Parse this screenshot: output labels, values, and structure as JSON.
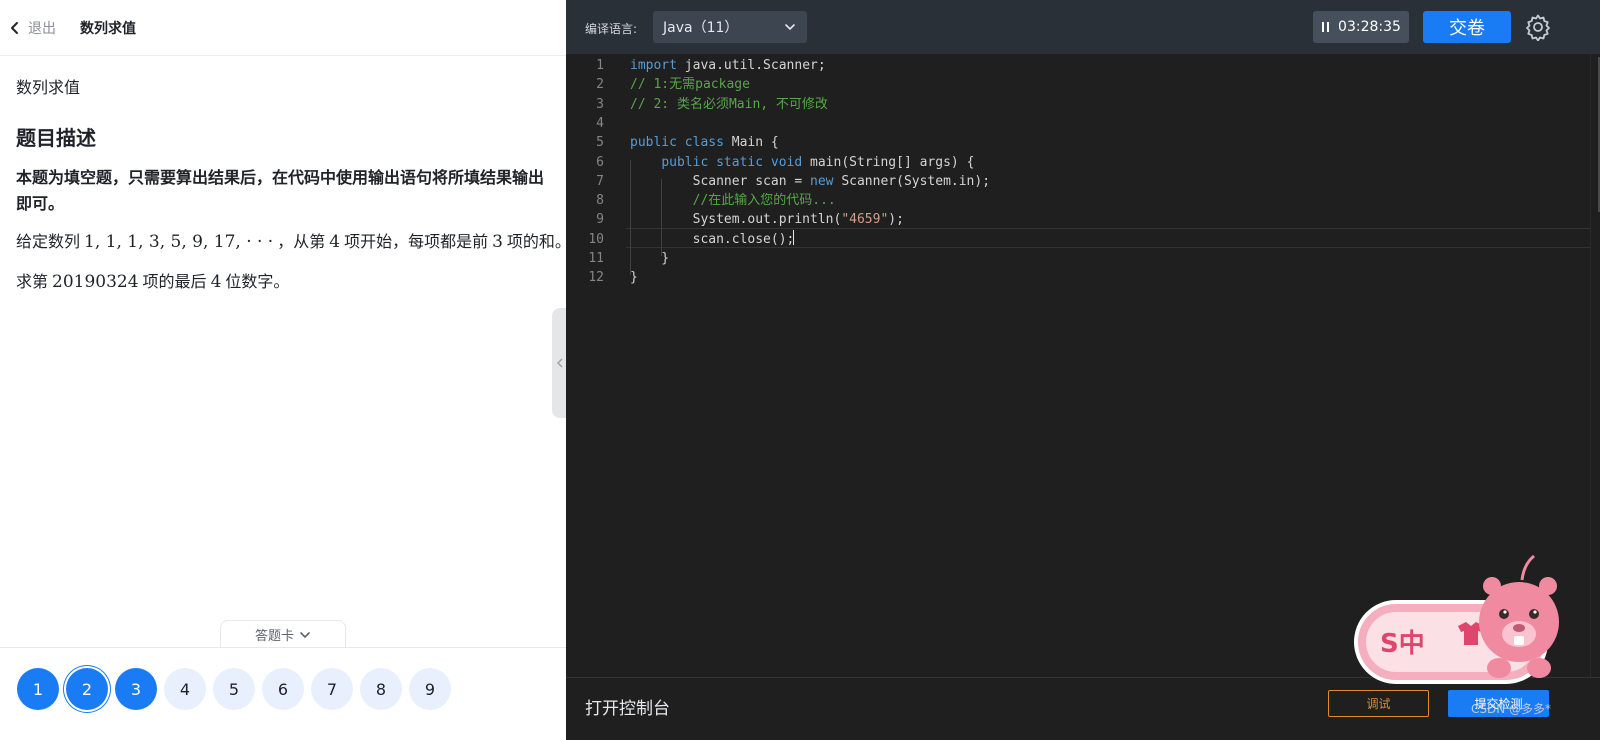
{
  "header": {
    "back_label": "退出",
    "title": "数列求值"
  },
  "problem": {
    "name": "数列求值",
    "section_heading": "题目描述",
    "note": "本题为填空题，只需要算出结果后，在代码中使用输出语句将所填结果输出即可。",
    "para1_prefix": "给定数列",
    "sequence": "1, 1, 1, 3, 5, 9, 17, · · ·",
    "para1_mid": "，从第",
    "start_index": "4",
    "para1_mid2": "项开始，每项都是前",
    "prev_count": "3",
    "para1_suffix": "项的和。",
    "para2_prefix": "求第",
    "target_index": "20190324",
    "para2_mid": "项的最后",
    "digit_count": "4",
    "para2_suffix": "位数字。"
  },
  "answer_card": {
    "label": "答题卡",
    "questions": [
      {
        "num": "1",
        "state": "done"
      },
      {
        "num": "2",
        "state": "current"
      },
      {
        "num": "3",
        "state": "done"
      },
      {
        "num": "4",
        "state": "todo"
      },
      {
        "num": "5",
        "state": "todo"
      },
      {
        "num": "6",
        "state": "todo"
      },
      {
        "num": "7",
        "state": "todo"
      },
      {
        "num": "8",
        "state": "todo"
      },
      {
        "num": "9",
        "state": "todo"
      }
    ]
  },
  "toolbar": {
    "lang_label": "编译语言:",
    "lang_value": "Java（11）",
    "timer": "03:28:35",
    "submit_exam": "交卷"
  },
  "editor": {
    "lines": [
      {
        "n": "1",
        "tokens": [
          {
            "t": "import",
            "c": "kw"
          },
          {
            "t": " java.util.Scanner;",
            "c": ""
          }
        ]
      },
      {
        "n": "2",
        "tokens": [
          {
            "t": "// 1:无需package",
            "c": "cm"
          }
        ]
      },
      {
        "n": "3",
        "tokens": [
          {
            "t": "// 2: 类名必须Main, 不可修改",
            "c": "cm"
          }
        ]
      },
      {
        "n": "4",
        "tokens": []
      },
      {
        "n": "5",
        "tokens": [
          {
            "t": "public class",
            "c": "kw"
          },
          {
            "t": " Main {",
            "c": ""
          }
        ]
      },
      {
        "n": "6",
        "tokens": [
          {
            "t": "    ",
            "c": ""
          },
          {
            "t": "public static void",
            "c": "kw"
          },
          {
            "t": " main(String[] args) {",
            "c": ""
          }
        ]
      },
      {
        "n": "7",
        "tokens": [
          {
            "t": "        Scanner scan = ",
            "c": ""
          },
          {
            "t": "new",
            "c": "kw"
          },
          {
            "t": " Scanner(System.in);",
            "c": ""
          }
        ]
      },
      {
        "n": "8",
        "tokens": [
          {
            "t": "        ",
            "c": ""
          },
          {
            "t": "//在此输入您的代码...",
            "c": "cm"
          }
        ]
      },
      {
        "n": "9",
        "tokens": [
          {
            "t": "        System.out.println(",
            "c": ""
          },
          {
            "t": "\"4659\"",
            "c": "str"
          },
          {
            "t": ");",
            "c": ""
          }
        ]
      },
      {
        "n": "10",
        "tokens": [
          {
            "t": "        scan.close();",
            "c": ""
          }
        ]
      },
      {
        "n": "11",
        "tokens": [
          {
            "t": "    }",
            "c": ""
          }
        ]
      },
      {
        "n": "12",
        "tokens": [
          {
            "t": "}",
            "c": ""
          }
        ]
      }
    ]
  },
  "bottom": {
    "console_toggle": "打开控制台",
    "debug_button": "调试",
    "submit_check_button": "提交检测",
    "watermark": "CSDN @多多*"
  },
  "mascot": {
    "badge_text": "S中"
  },
  "colors": {
    "accent": "#1a7cf5",
    "debug_orange": "#e38a2b",
    "editor_bg": "#1f1f1f",
    "toolbar_bg": "#2a3038"
  }
}
